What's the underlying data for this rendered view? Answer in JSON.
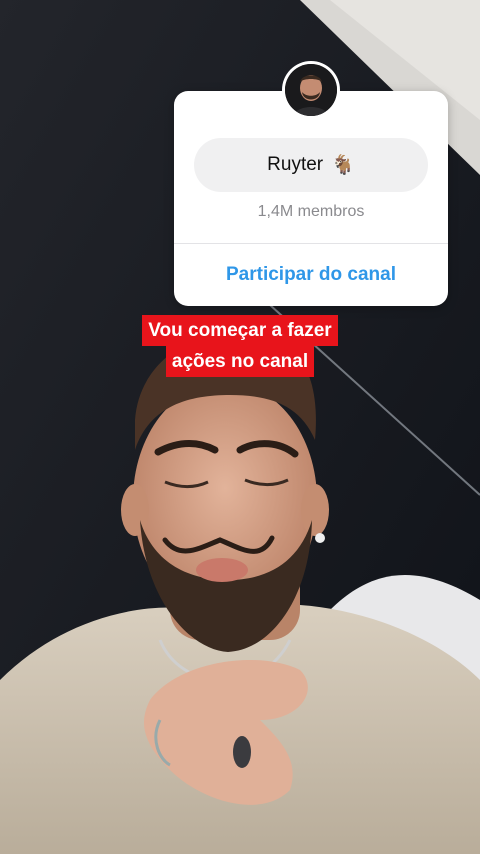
{
  "channel_card": {
    "name": "Ruyter",
    "emoji": "🐐",
    "members": "1,4M membros",
    "join_label": "Participar do canal"
  },
  "caption": {
    "line1": "Vou começar a fazer",
    "line2": "ações no canal"
  },
  "icons": {
    "avatar": "avatar-icon",
    "emoji": "goat-emoji-icon"
  },
  "colors": {
    "accent": "#2f97e8",
    "caption_bg": "#e8141b"
  }
}
